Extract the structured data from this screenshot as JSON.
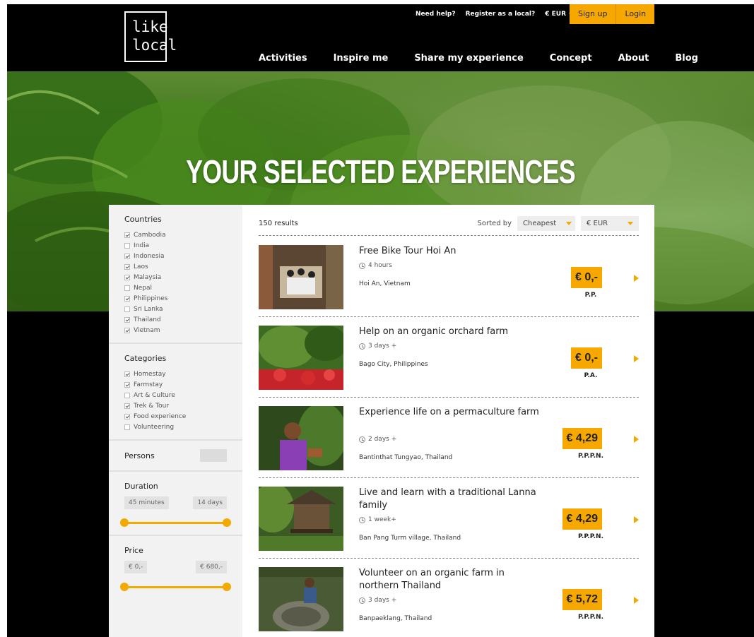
{
  "logo": {
    "line1": "like",
    "line2": "local"
  },
  "topbar": {
    "help": "Need help?",
    "register": "Register as a local?",
    "currency": "€ EUR"
  },
  "auth": {
    "signup": "Sign up",
    "login": "Login"
  },
  "nav": [
    "Activities",
    "Inspire me",
    "Share my experience",
    "Concept",
    "About",
    "Blog"
  ],
  "hero": {
    "title": "YOUR SELECTED EXPERIENCES"
  },
  "filters": {
    "countries_title": "Countries",
    "countries": [
      {
        "label": "Cambodia",
        "checked": true
      },
      {
        "label": "India",
        "checked": false
      },
      {
        "label": "Indonesia",
        "checked": true
      },
      {
        "label": "Laos",
        "checked": true
      },
      {
        "label": "Malaysia",
        "checked": true
      },
      {
        "label": "Nepal",
        "checked": false
      },
      {
        "label": "Philippines",
        "checked": true
      },
      {
        "label": "Sri Lanka",
        "checked": false
      },
      {
        "label": "Thailand",
        "checked": true
      },
      {
        "label": "Vietnam",
        "checked": true
      }
    ],
    "categories_title": "Categories",
    "categories": [
      {
        "label": "Homestay",
        "checked": true
      },
      {
        "label": "Farmstay",
        "checked": true
      },
      {
        "label": "Art & Culture",
        "checked": false
      },
      {
        "label": "Trek & Tour",
        "checked": true
      },
      {
        "label": "Food experience",
        "checked": true
      },
      {
        "label": "Volunteering",
        "checked": false
      }
    ],
    "persons_title": "Persons",
    "duration_title": "Duration",
    "duration_min": "45 minutes",
    "duration_max": "14 days",
    "price_title": "Price",
    "price_min": "€ 0,-",
    "price_max": "€ 680,-"
  },
  "results": {
    "count": "150 results",
    "sorted_by": "Sorted by",
    "sort_value": "Cheapest",
    "currency_value": "€ EUR",
    "items": [
      {
        "title": "Free Bike Tour Hoi An",
        "duration": "4 hours",
        "location": "Hoi An, Vietnam",
        "price": "€ 0,-",
        "unit": "P.P."
      },
      {
        "title": "Help on an organic orchard farm",
        "duration": "3 days +",
        "location": "Bago City, Philippines",
        "price": "€ 0,-",
        "unit": "P.A."
      },
      {
        "title": "Experience life on a permaculture farm",
        "duration": "2 days +",
        "location": "Bantinthat Tungyao, Thailand",
        "price": "€ 4,29",
        "unit": "P.P.P.N."
      },
      {
        "title": "Live and learn with a traditional Lanna family",
        "duration": "1 week+",
        "location": "Ban Pang Turm village, Thailand",
        "price": "€ 4,29",
        "unit": "P.P.P.N."
      },
      {
        "title": "Volunteer on an organic farm in northern Thailand",
        "duration": "3 days +",
        "location": "Banpaeklang, Thailand",
        "price": "€ 5,72",
        "unit": "P.P.P.N."
      }
    ]
  }
}
